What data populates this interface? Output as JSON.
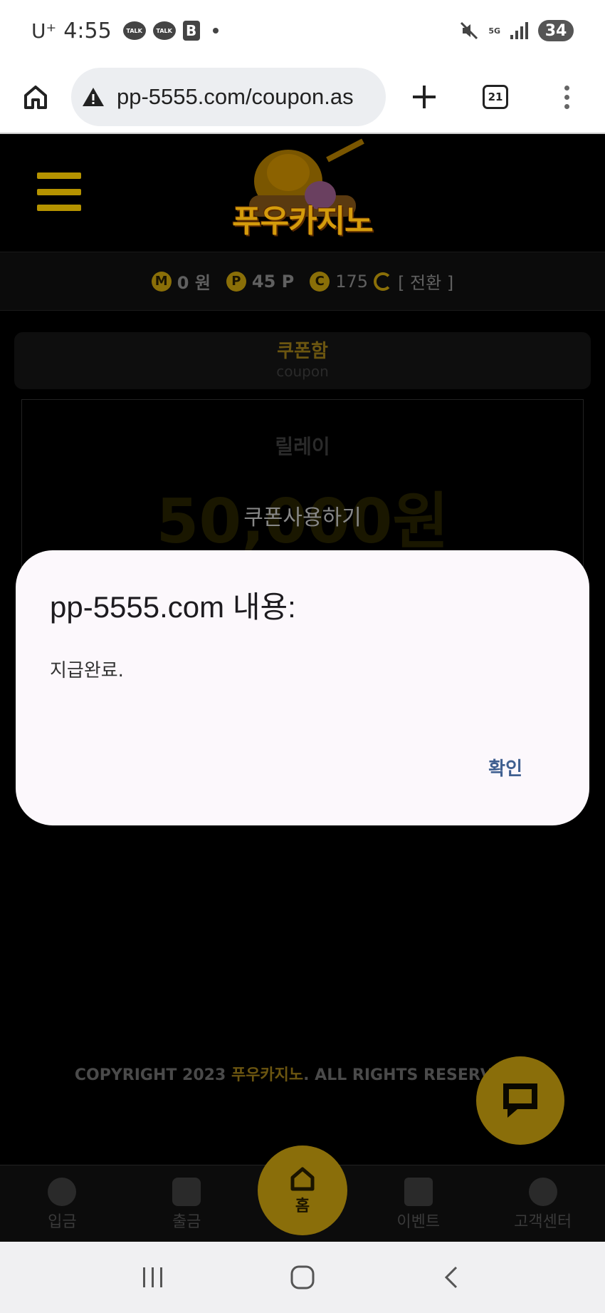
{
  "status_bar": {
    "carrier": "U⁺",
    "time": "4:55",
    "notif1": "TALK",
    "notif2": "TALK",
    "notif3": "B",
    "network": "5G",
    "battery": "34"
  },
  "browser": {
    "url": "pp-5555.com/coupon.as",
    "tab_count": "21"
  },
  "site": {
    "logo_text": "푸우카지노",
    "balance": {
      "m_icon": "M",
      "money": "0 원",
      "p_icon": "P",
      "points": "45 P",
      "c_icon": "C",
      "coins": "175",
      "convert_label": "[ 전환 ]"
    },
    "coupon_tab": {
      "title": "쿠폰함",
      "subtitle": "coupon"
    },
    "coupon_card": {
      "name": "릴레이",
      "amount": "50,000원",
      "use_button": "쿠폰사용하기"
    },
    "copyright": {
      "prefix": "COPYRIGHT 2023 ",
      "brand": "푸우카지노",
      "suffix": ". ALL RIGHTS RESERVED"
    },
    "bottom_nav": {
      "deposit": "입금",
      "withdraw": "출금",
      "home": "홈",
      "event": "이벤트",
      "support": "고객센터"
    }
  },
  "dialog": {
    "title": "pp-5555.com 내용:",
    "message": "지급완료.",
    "ok_button": "확인"
  }
}
